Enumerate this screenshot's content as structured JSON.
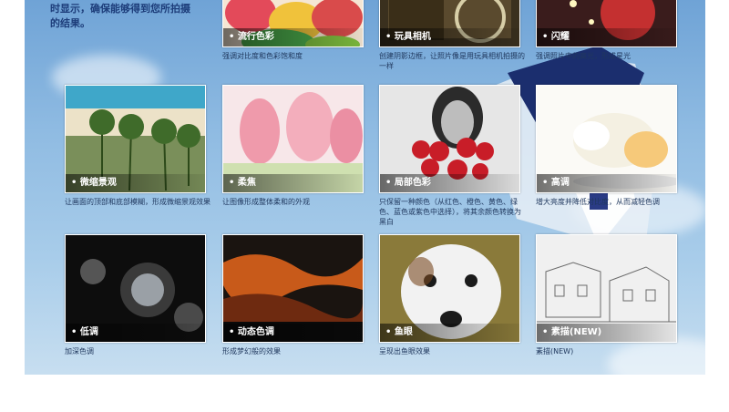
{
  "intro": [
    "时显示，确保能够得到您所拍摄",
    "的结果。"
  ],
  "cards": [
    {
      "label": "流行色彩",
      "desc": "强调对比度和色彩饱和度"
    },
    {
      "label": "玩具相机",
      "desc": "创建阴影边框，让照片像是用玩具相机拍摄的一样"
    },
    {
      "label": "闪耀",
      "desc": "强调照片中的高光，形成星光"
    },
    {
      "label": "微缩景观",
      "desc": "让画面的顶部和底部模糊，形成微缩景观效果"
    },
    {
      "label": "柔焦",
      "desc": "让图像形成整体柔和的外观"
    },
    {
      "label": "局部色彩",
      "desc": "只保留一种颜色（从红色、橙色、黄色、绿色、蓝色或紫色中选择），将其余颜色转换为黑白"
    },
    {
      "label": "高调",
      "desc": "增大亮度并降低对比度，从而减轻色调"
    },
    {
      "label": "低调",
      "desc": "加深色调"
    },
    {
      "label": "动态色调",
      "desc": "形成梦幻般的效果"
    },
    {
      "label": "鱼眼",
      "desc": "呈现出鱼眼效果"
    },
    {
      "label": "素描(NEW)",
      "desc": "素描(NEW)"
    }
  ]
}
